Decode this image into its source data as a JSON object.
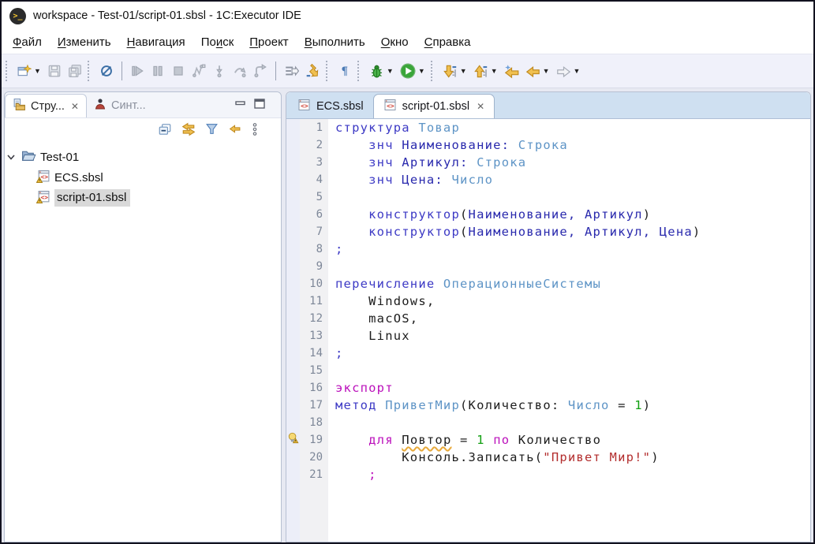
{
  "window": {
    "title": "workspace - Test-01/script-01.sbsl - 1C:Executor IDE",
    "app_icon": "executor-terminal-icon"
  },
  "menubar": {
    "items": [
      {
        "label": "Файл",
        "pre": "",
        "key": "Ф",
        "post": "айл"
      },
      {
        "label": "Изменить",
        "pre": "",
        "key": "И",
        "post": "зменить"
      },
      {
        "label": "Навигация",
        "pre": "",
        "key": "Н",
        "post": "авигация"
      },
      {
        "label": "Поиск",
        "pre": "По",
        "key": "и",
        "post": "ск"
      },
      {
        "label": "Проект",
        "pre": "",
        "key": "П",
        "post": "роект"
      },
      {
        "label": "Выполнить",
        "pre": "",
        "key": "В",
        "post": "ыполнить"
      },
      {
        "label": "Окно",
        "pre": "",
        "key": "О",
        "post": "кно"
      },
      {
        "label": "Справка",
        "pre": "",
        "key": "С",
        "post": "правка"
      }
    ]
  },
  "toolbar": {
    "icons": [
      "new-wizard",
      "save",
      "save-all",
      "skip-all-breakpoints",
      "resume",
      "pause",
      "terminate",
      "step-filters",
      "step-into",
      "step-over",
      "step-return",
      "run-to-line",
      "drop-to-frame",
      "show-whitespace",
      "debug",
      "run",
      "next-annotation",
      "previous-annotation",
      "last-edit-location",
      "back",
      "forward"
    ],
    "colors": {
      "enabled_yellow": "#f0c050",
      "enabled_green": "#35a435",
      "enabled_blue": "#3a6ea5",
      "disabled_grey": "#b7bcc6"
    }
  },
  "left_panel": {
    "tabs": [
      {
        "label": "Стру...",
        "icon": "structure-explorer-icon",
        "active": true,
        "closable": true
      },
      {
        "label": "Синт...",
        "icon": "syntax-icon",
        "active": false
      }
    ],
    "toolbar_icons": [
      "collapse-all",
      "link-with-editor",
      "filter",
      "focus-back-arrow",
      "view-menu"
    ],
    "tree": [
      {
        "label": "Test-01",
        "type": "project-folder",
        "expanded": true
      },
      {
        "label": "ECS.sbsl",
        "type": "sbsl-file",
        "warning": true
      },
      {
        "label": "script-01.sbsl",
        "type": "sbsl-file",
        "warning": true,
        "selected": true
      }
    ]
  },
  "editor": {
    "tabs": [
      {
        "label": "ECS.sbsl",
        "icon": "sbsl-file-icon",
        "active": false
      },
      {
        "label": "script-01.sbsl",
        "icon": "sbsl-file-icon",
        "active": true,
        "closable": true
      }
    ],
    "code": {
      "lines": [
        {
          "n": 1,
          "tokens": [
            {
              "t": "структура ",
              "c": "kw"
            },
            {
              "t": "Товар",
              "c": "type"
            }
          ]
        },
        {
          "n": 2,
          "tokens": [
            {
              "t": "    ",
              "c": "plain"
            },
            {
              "t": "знч ",
              "c": "kw"
            },
            {
              "t": "Наименование:",
              "c": "decl"
            },
            {
              "t": " ",
              "c": "plain"
            },
            {
              "t": "Строка",
              "c": "type"
            }
          ]
        },
        {
          "n": 3,
          "tokens": [
            {
              "t": "    ",
              "c": "plain"
            },
            {
              "t": "знч ",
              "c": "kw"
            },
            {
              "t": "Артикул:",
              "c": "decl"
            },
            {
              "t": " ",
              "c": "plain"
            },
            {
              "t": "Строка",
              "c": "type"
            }
          ]
        },
        {
          "n": 4,
          "tokens": [
            {
              "t": "    ",
              "c": "plain"
            },
            {
              "t": "знч ",
              "c": "kw"
            },
            {
              "t": "Цена:",
              "c": "decl"
            },
            {
              "t": " ",
              "c": "plain"
            },
            {
              "t": "Число",
              "c": "type"
            }
          ]
        },
        {
          "n": 5,
          "tokens": []
        },
        {
          "n": 6,
          "tokens": [
            {
              "t": "    ",
              "c": "plain"
            },
            {
              "t": "конструктор",
              "c": "kw"
            },
            {
              "t": "(",
              "c": "plain"
            },
            {
              "t": "Наименование, Артикул",
              "c": "decl"
            },
            {
              "t": ")",
              "c": "plain"
            }
          ]
        },
        {
          "n": 7,
          "tokens": [
            {
              "t": "    ",
              "c": "plain"
            },
            {
              "t": "конструктор",
              "c": "kw"
            },
            {
              "t": "(",
              "c": "plain"
            },
            {
              "t": "Наименование, Артикул, Цена",
              "c": "decl"
            },
            {
              "t": ")",
              "c": "plain"
            }
          ]
        },
        {
          "n": 8,
          "tokens": [
            {
              "t": ";",
              "c": "kw"
            }
          ]
        },
        {
          "n": 9,
          "tokens": []
        },
        {
          "n": 10,
          "tokens": [
            {
              "t": "перечисление ",
              "c": "kw"
            },
            {
              "t": "ОперационныеСистемы",
              "c": "type"
            }
          ]
        },
        {
          "n": 11,
          "tokens": [
            {
              "t": "    Windows,",
              "c": "plain"
            }
          ]
        },
        {
          "n": 12,
          "tokens": [
            {
              "t": "    macOS,",
              "c": "plain"
            }
          ]
        },
        {
          "n": 13,
          "tokens": [
            {
              "t": "    Linux",
              "c": "plain"
            }
          ]
        },
        {
          "n": 14,
          "tokens": [
            {
              "t": ";",
              "c": "kw"
            }
          ]
        },
        {
          "n": 15,
          "tokens": []
        },
        {
          "n": 16,
          "tokens": [
            {
              "t": "экспорт",
              "c": "mag"
            }
          ]
        },
        {
          "n": 17,
          "tokens": [
            {
              "t": "метод ",
              "c": "kw"
            },
            {
              "t": "ПриветМир",
              "c": "type"
            },
            {
              "t": "(Количество: ",
              "c": "plain"
            },
            {
              "t": "Число",
              "c": "type"
            },
            {
              "t": " = ",
              "c": "plain"
            },
            {
              "t": "1",
              "c": "num"
            },
            {
              "t": ")",
              "c": "plain"
            }
          ]
        },
        {
          "n": 18,
          "tokens": []
        },
        {
          "n": 19,
          "g": "quickfix-warning",
          "tokens": [
            {
              "t": "    ",
              "c": "plain"
            },
            {
              "t": "для ",
              "c": "mag"
            },
            {
              "t": "Повтор",
              "c": "plain",
              "w": true
            },
            {
              "t": " = ",
              "c": "plain"
            },
            {
              "t": "1",
              "c": "num"
            },
            {
              "t": " ",
              "c": "plain"
            },
            {
              "t": "по",
              "c": "mag"
            },
            {
              "t": " Количество",
              "c": "plain"
            }
          ]
        },
        {
          "n": 20,
          "tokens": [
            {
              "t": "        Консоль.Записать(",
              "c": "plain"
            },
            {
              "t": "\"Привет Мир!\"",
              "c": "str"
            },
            {
              "t": ")",
              "c": "plain"
            }
          ]
        },
        {
          "n": 21,
          "tokens": [
            {
              "t": "    ",
              "c": "plain"
            },
            {
              "t": ";",
              "c": "mag"
            }
          ]
        }
      ]
    }
  }
}
